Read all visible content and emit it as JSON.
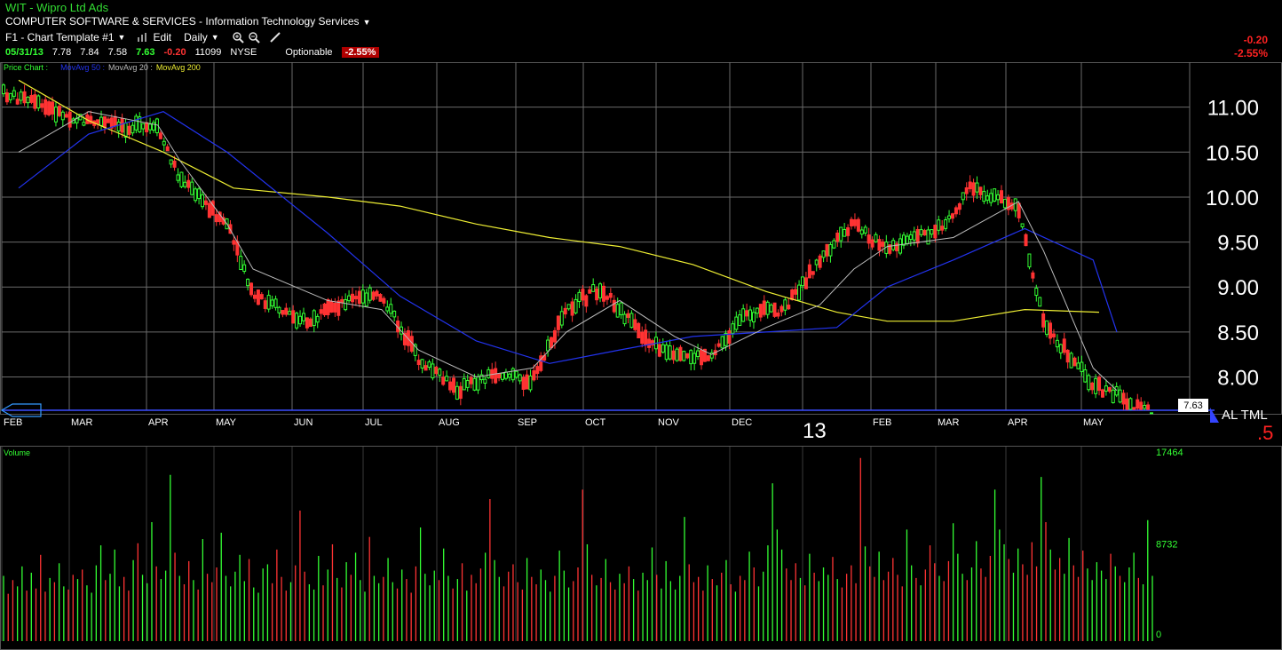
{
  "window": {
    "title": "WIT - Wipro Ltd Ads",
    "industry": "COMPUTER SOFTWARE & SERVICES - Information Technology Services"
  },
  "toolbar": {
    "template": "F1 - Chart Template #1",
    "edit": "Edit",
    "interval": "Daily"
  },
  "quote": {
    "date": "05/31/13",
    "open": "7.78",
    "high": "7.84",
    "low": "7.58",
    "close": "7.63",
    "change": "-0.20",
    "volume": "11099",
    "exchange": "NYSE",
    "optionable": "Optionable",
    "change_pct": "-2.55%"
  },
  "right_change": {
    "change": "-0.20",
    "pct": "-2.55%"
  },
  "colors": {
    "up": "#33ff33",
    "down": "#ff3333",
    "ma20": "#bbbbbb",
    "ma50": "#2233ee",
    "ma200": "#eeee33",
    "grid": "#6a6a6a"
  },
  "chart_data": {
    "type": "candlestick",
    "legend": [
      "Price Chart",
      "MovAvg 50",
      "MovAvg 20",
      "MovAvg 200"
    ],
    "y_ticks": [
      "11.00",
      "10.50",
      "10.00",
      "9.50",
      "9.00",
      "8.50",
      "8.00"
    ],
    "ylim": [
      7.63,
      11.5
    ],
    "last_price": "7.63",
    "x_months": [
      "FEB",
      "MAR",
      "APR",
      "MAY",
      "JUN",
      "JUL",
      "AUG",
      "SEP",
      "OCT",
      "NOV",
      "DEC",
      "13",
      "FEB",
      "MAR",
      "APR",
      "MAY"
    ],
    "right_markers": {
      "letters": "AL TML",
      "red": ".5"
    },
    "close_path": [
      [
        "FEB",
        11.1
      ],
      [
        "MAR",
        10.85
      ],
      [
        "APR",
        10.75
      ],
      [
        "APR",
        10.2
      ],
      [
        "MAY",
        9.7
      ],
      [
        "MAY",
        8.9
      ],
      [
        "JUN",
        8.6
      ],
      [
        "JUN",
        8.85
      ],
      [
        "JUL",
        8.9
      ],
      [
        "JUL",
        8.2
      ],
      [
        "AUG",
        7.85
      ],
      [
        "AUG",
        8.05
      ],
      [
        "SEP",
        7.95
      ],
      [
        "SEP",
        8.75
      ],
      [
        "OCT",
        9.0
      ],
      [
        "OCT",
        8.5
      ],
      [
        "NOV",
        8.2
      ],
      [
        "NOV",
        8.25
      ],
      [
        "DEC",
        8.7
      ],
      [
        "DEC",
        8.75
      ],
      [
        "13",
        9.3
      ],
      [
        "13",
        9.7
      ],
      [
        "FEB",
        9.4
      ],
      [
        "MAR",
        9.7
      ],
      [
        "MAR",
        10.1
      ],
      [
        "APR",
        9.9
      ],
      [
        "APR",
        8.6
      ],
      [
        "MAY",
        7.9
      ],
      [
        "MAY",
        7.8
      ],
      [
        "MAY",
        7.63
      ]
    ],
    "ma20": [
      [
        "FEB",
        10.5
      ],
      [
        "MAR",
        10.95
      ],
      [
        "APR",
        10.8
      ],
      [
        "APR",
        10.4
      ],
      [
        "MAY",
        9.7
      ],
      [
        "MAY",
        9.2
      ],
      [
        "JUN",
        8.85
      ],
      [
        "JUL",
        8.75
      ],
      [
        "JUL",
        8.3
      ],
      [
        "AUG",
        8.0
      ],
      [
        "SEP",
        8.1
      ],
      [
        "SEP",
        8.5
      ],
      [
        "OCT",
        8.85
      ],
      [
        "NOV",
        8.45
      ],
      [
        "NOV",
        8.25
      ],
      [
        "DEC",
        8.55
      ],
      [
        "13",
        8.8
      ],
      [
        "13",
        9.2
      ],
      [
        "FEB",
        9.45
      ],
      [
        "MAR",
        9.55
      ],
      [
        "APR",
        9.95
      ],
      [
        "APR",
        9.4
      ],
      [
        "MAY",
        8.1
      ],
      [
        "MAY",
        7.85
      ]
    ],
    "ma50": [
      [
        "FEB",
        10.1
      ],
      [
        "MAR",
        10.7
      ],
      [
        "APR",
        10.95
      ],
      [
        "MAY",
        10.5
      ],
      [
        "JUN",
        9.6
      ],
      [
        "JUL",
        8.9
      ],
      [
        "AUG",
        8.4
      ],
      [
        "SEP",
        8.15
      ],
      [
        "OCT",
        8.3
      ],
      [
        "NOV",
        8.45
      ],
      [
        "DEC",
        8.5
      ],
      [
        "13",
        8.55
      ],
      [
        "FEB",
        9.0
      ],
      [
        "MAR",
        9.3
      ],
      [
        "APR",
        9.65
      ],
      [
        "MAY",
        9.3
      ],
      [
        "MAY",
        8.5
      ]
    ],
    "ma200": [
      [
        "FEB",
        11.3
      ],
      [
        "MAR",
        10.85
      ],
      [
        "APR",
        10.5
      ],
      [
        "MAY",
        10.1
      ],
      [
        "JUN",
        10.0
      ],
      [
        "JUL",
        9.9
      ],
      [
        "AUG",
        9.7
      ],
      [
        "SEP",
        9.55
      ],
      [
        "OCT",
        9.45
      ],
      [
        "NOV",
        9.25
      ],
      [
        "DEC",
        8.95
      ],
      [
        "13",
        8.72
      ],
      [
        "FEB",
        8.62
      ],
      [
        "MAR",
        8.62
      ],
      [
        "APR",
        8.75
      ],
      [
        "MAY",
        8.72
      ]
    ],
    "volume": {
      "label": "Volume",
      "ticks": [
        "17464",
        "8732",
        "0"
      ],
      "max": 17464,
      "bars": [
        6200,
        4500,
        5800,
        5200,
        7100,
        4800,
        6500,
        5000,
        8200,
        4700,
        6000,
        5600,
        7400,
        5200,
        4900,
        6300,
        5900,
        6800,
        5300,
        4600,
        7200,
        9100,
        5800,
        6400,
        8700,
        5200,
        6100,
        4800,
        7700,
        9300,
        6300,
        5500,
        11300,
        7100,
        5900,
        6700,
        15800,
        8400,
        6200,
        5400,
        7600,
        5800,
        4900,
        9700,
        6400,
        5600,
        7000,
        10300,
        6200,
        5200,
        6600,
        8200,
        5700,
        7800,
        5100,
        4600,
        6900,
        7300,
        5500,
        8700,
        6100,
        4800,
        5600,
        7200,
        12400,
        6600,
        5400,
        4900,
        8100,
        5300,
        6800,
        9200,
        6000,
        5100,
        7500,
        6300,
        8400,
        5800,
        4700,
        9900,
        6200,
        5500,
        6100,
        7900,
        5600,
        5000,
        6800,
        5900,
        4600,
        7100,
        10800,
        6400,
        5300,
        6700,
        5800,
        8800,
        6200,
        5000,
        5900,
        7400,
        4800,
        6300,
        5500,
        6900,
        8400,
        13500,
        7700,
        6100,
        5200,
        6600,
        7300,
        5600,
        4900,
        7900,
        6100,
        5400,
        6800,
        5800,
        4700,
        6200,
        8600,
        6700,
        5100,
        5700,
        7000,
        14400,
        9200,
        6300,
        5300,
        6000,
        7800,
        5600,
        4900,
        6400,
        5500,
        7100,
        5900,
        4800,
        6500,
        5800,
        8900,
        6300,
        5000,
        7600,
        5700,
        4900,
        6200,
        11800,
        7300,
        5600,
        6100,
        4800,
        7200,
        5900,
        5300,
        6500,
        7700,
        5400,
        4700,
        6200,
        5800,
        8500,
        7000,
        5200,
        6600,
        9100,
        15000,
        10600,
        8700,
        6900,
        5800,
        7400,
        6000,
        5300,
        8300,
        6500,
        5700,
        7000,
        6300,
        8000,
        5900,
        5100,
        6400,
        7200,
        5500,
        17400,
        9000,
        7100,
        6100,
        8500,
        5800,
        6600,
        7900,
        6300,
        5200,
        10600,
        7200,
        6000,
        5300,
        6800,
        9100,
        7400,
        6200,
        5700,
        7600,
        11200,
        8300,
        6400,
        5800,
        7000,
        9500,
        6900,
        6100,
        8100,
        14400,
        10600,
        9200,
        7800,
        6500,
        8800,
        7300,
        6300,
        9400,
        7100,
        15600,
        11300,
        8700,
        6800,
        7900,
        6400,
        9800,
        7200,
        6100,
        8600,
        6900,
        5800,
        7500,
        6700,
        5900,
        8300,
        7100,
        6200,
        5600,
        7000,
        8400,
        6000,
        5400,
        11500,
        6200
      ]
    }
  }
}
